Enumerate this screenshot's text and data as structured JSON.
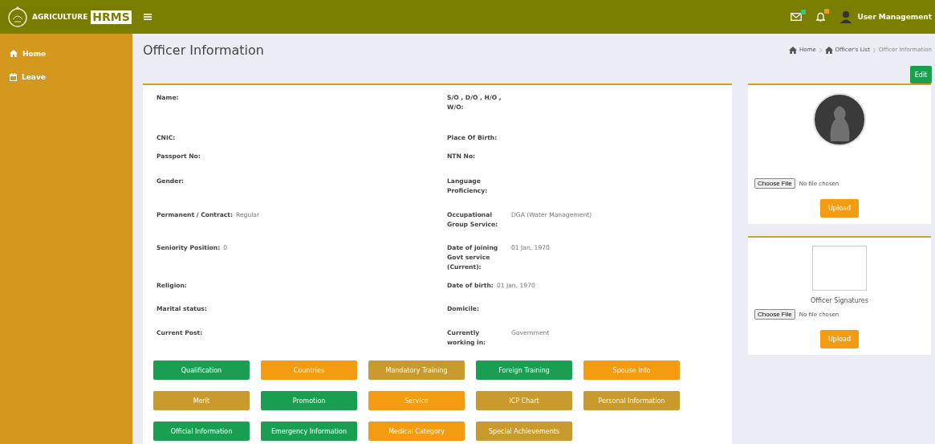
{
  "header": {
    "brand": "AGRICULTURE",
    "brand_badge": "HRMS",
    "user": "User Management"
  },
  "sidebar": {
    "items": [
      {
        "label": "Home",
        "kind": "home"
      },
      {
        "label": "Leave",
        "kind": "calendar"
      }
    ]
  },
  "page": {
    "title": "Officer Information",
    "breadcrumb": [
      {
        "label": "Home",
        "kind": "link"
      },
      {
        "label": "Officer's List",
        "kind": "link"
      },
      {
        "label": "Officer Information",
        "kind": "current"
      }
    ]
  },
  "edit_button": "Edit",
  "fields": [
    {
      "left": {
        "label": "Name:"
      },
      "right": {
        "label": "S/O , D/O , H/O , W/O:"
      }
    },
    {
      "left": {
        "label": "CNIC:"
      },
      "right": {
        "label": "Place Of Birth:"
      }
    },
    {
      "left": {
        "label": "Passport No:"
      },
      "right": {
        "label": "NTN No:"
      }
    },
    {
      "left": {
        "label": "Gender:"
      },
      "right": {
        "label": "Language Proficiency:"
      }
    },
    {
      "left": {
        "label": "Permanent / Contract:",
        "value": "Regular"
      },
      "right": {
        "label": "Occupational Group Service:",
        "value": "DGA (Water Management)"
      }
    },
    {
      "left": {
        "label": "Seniority Position:",
        "value": "0"
      },
      "right": {
        "label": "Date of joining Govt service (Current):",
        "value": "01 Jan, 1970"
      }
    },
    {
      "left": {
        "label": "Religion:"
      },
      "right": {
        "label": "Date of birth:",
        "value": "01 Jan, 1970"
      }
    },
    {
      "left": {
        "label": "Marital status:"
      },
      "right": {
        "label": "Domicile:"
      }
    },
    {
      "left": {
        "label": "Current Post:"
      },
      "right": {
        "label": "Currently working in:",
        "value": "Government"
      }
    }
  ],
  "sections": [
    {
      "label": "Qualification",
      "color": "#1a9e52"
    },
    {
      "label": "Countries",
      "color": "#f39c12"
    },
    {
      "label": "Mandatory Training",
      "color": "#c99a2e"
    },
    {
      "label": "Foreign Training",
      "color": "#1a9e52"
    },
    {
      "label": "Spouse Info",
      "color": "#f39c12"
    },
    {
      "label": "Merit",
      "color": "#c99a2e"
    },
    {
      "label": "Promotion",
      "color": "#1a9e52"
    },
    {
      "label": "Service",
      "color": "#f39c12"
    },
    {
      "label": "ICP Chart",
      "color": "#c99a2e"
    },
    {
      "label": "Personal Information",
      "color": "#c99a2e"
    },
    {
      "label": "Official Information",
      "color": "#1a9e52"
    },
    {
      "label": "Emergency Information",
      "color": "#1a9e52"
    },
    {
      "label": "Medical Category",
      "color": "#f39c12"
    },
    {
      "label": "Special Achievements",
      "color": "#c99a2e"
    }
  ],
  "photo_card": {
    "file_button": "Choose File",
    "file_status": "No file chosen",
    "upload": "Upload"
  },
  "signature_card": {
    "caption": "Officer Signatures",
    "file_button": "Choose File",
    "file_status": "No file chosen",
    "upload": "Upload"
  }
}
